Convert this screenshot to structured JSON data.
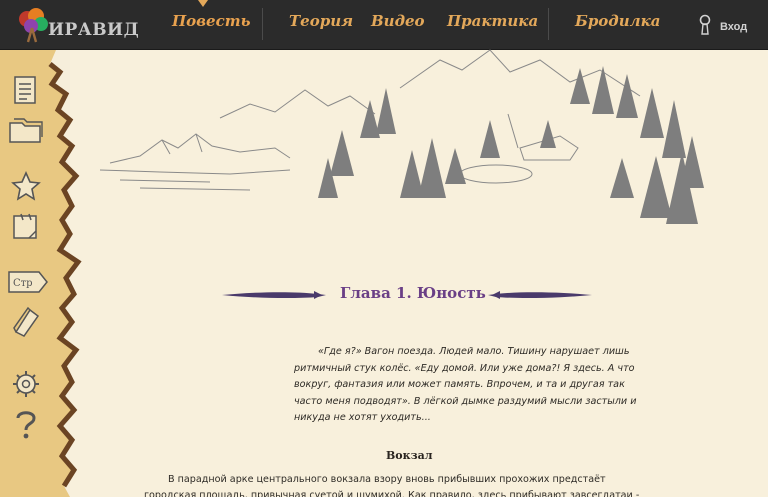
{
  "app": {
    "logo_text": "ИРАВИД"
  },
  "nav": {
    "items": [
      {
        "label": "Повесть",
        "active": true
      },
      {
        "label": "Теория"
      },
      {
        "label": "Видео"
      },
      {
        "label": "Практика"
      },
      {
        "label": "Бродилка"
      }
    ],
    "login_label": "Вход"
  },
  "toolbar": {
    "items": [
      {
        "icon": "document-icon"
      },
      {
        "icon": "folders-icon"
      },
      {
        "icon": "star-icon"
      },
      {
        "icon": "notes-icon"
      },
      {
        "icon": "page-label-icon",
        "label": "Стр"
      },
      {
        "icon": "book-icon"
      },
      {
        "icon": "gear-icon"
      },
      {
        "icon": "help-icon"
      }
    ]
  },
  "chapter": {
    "title": "Глава 1. Юность",
    "intro": "«Где я?» Вагон поезда. Людей мало. Тишину нарушает лишь ритмичный стук колёс. «Еду домой. Или уже дома?! Я здесь. А что вокруг, фантазия или может память. Впрочем, и та и другая так часто меня подводят». В лёгкой дымке раздумий мысли застыли и никуда не хотят уходить...",
    "section_title": "Вокзал",
    "body": "В парадной арке центрального вокзала взору вновь прибывших прохожих предстаёт городская площадь, привычная суетой и шумихой. Как правило, здесь прибывают завсегдатаи - уверенные в"
  },
  "colors": {
    "topbar": "#2b2b2b",
    "nav_text": "#e3a85a",
    "paper": "#f8f0dc",
    "chapter_title": "#6a3f86",
    "sketch": "#7a7a7a"
  }
}
